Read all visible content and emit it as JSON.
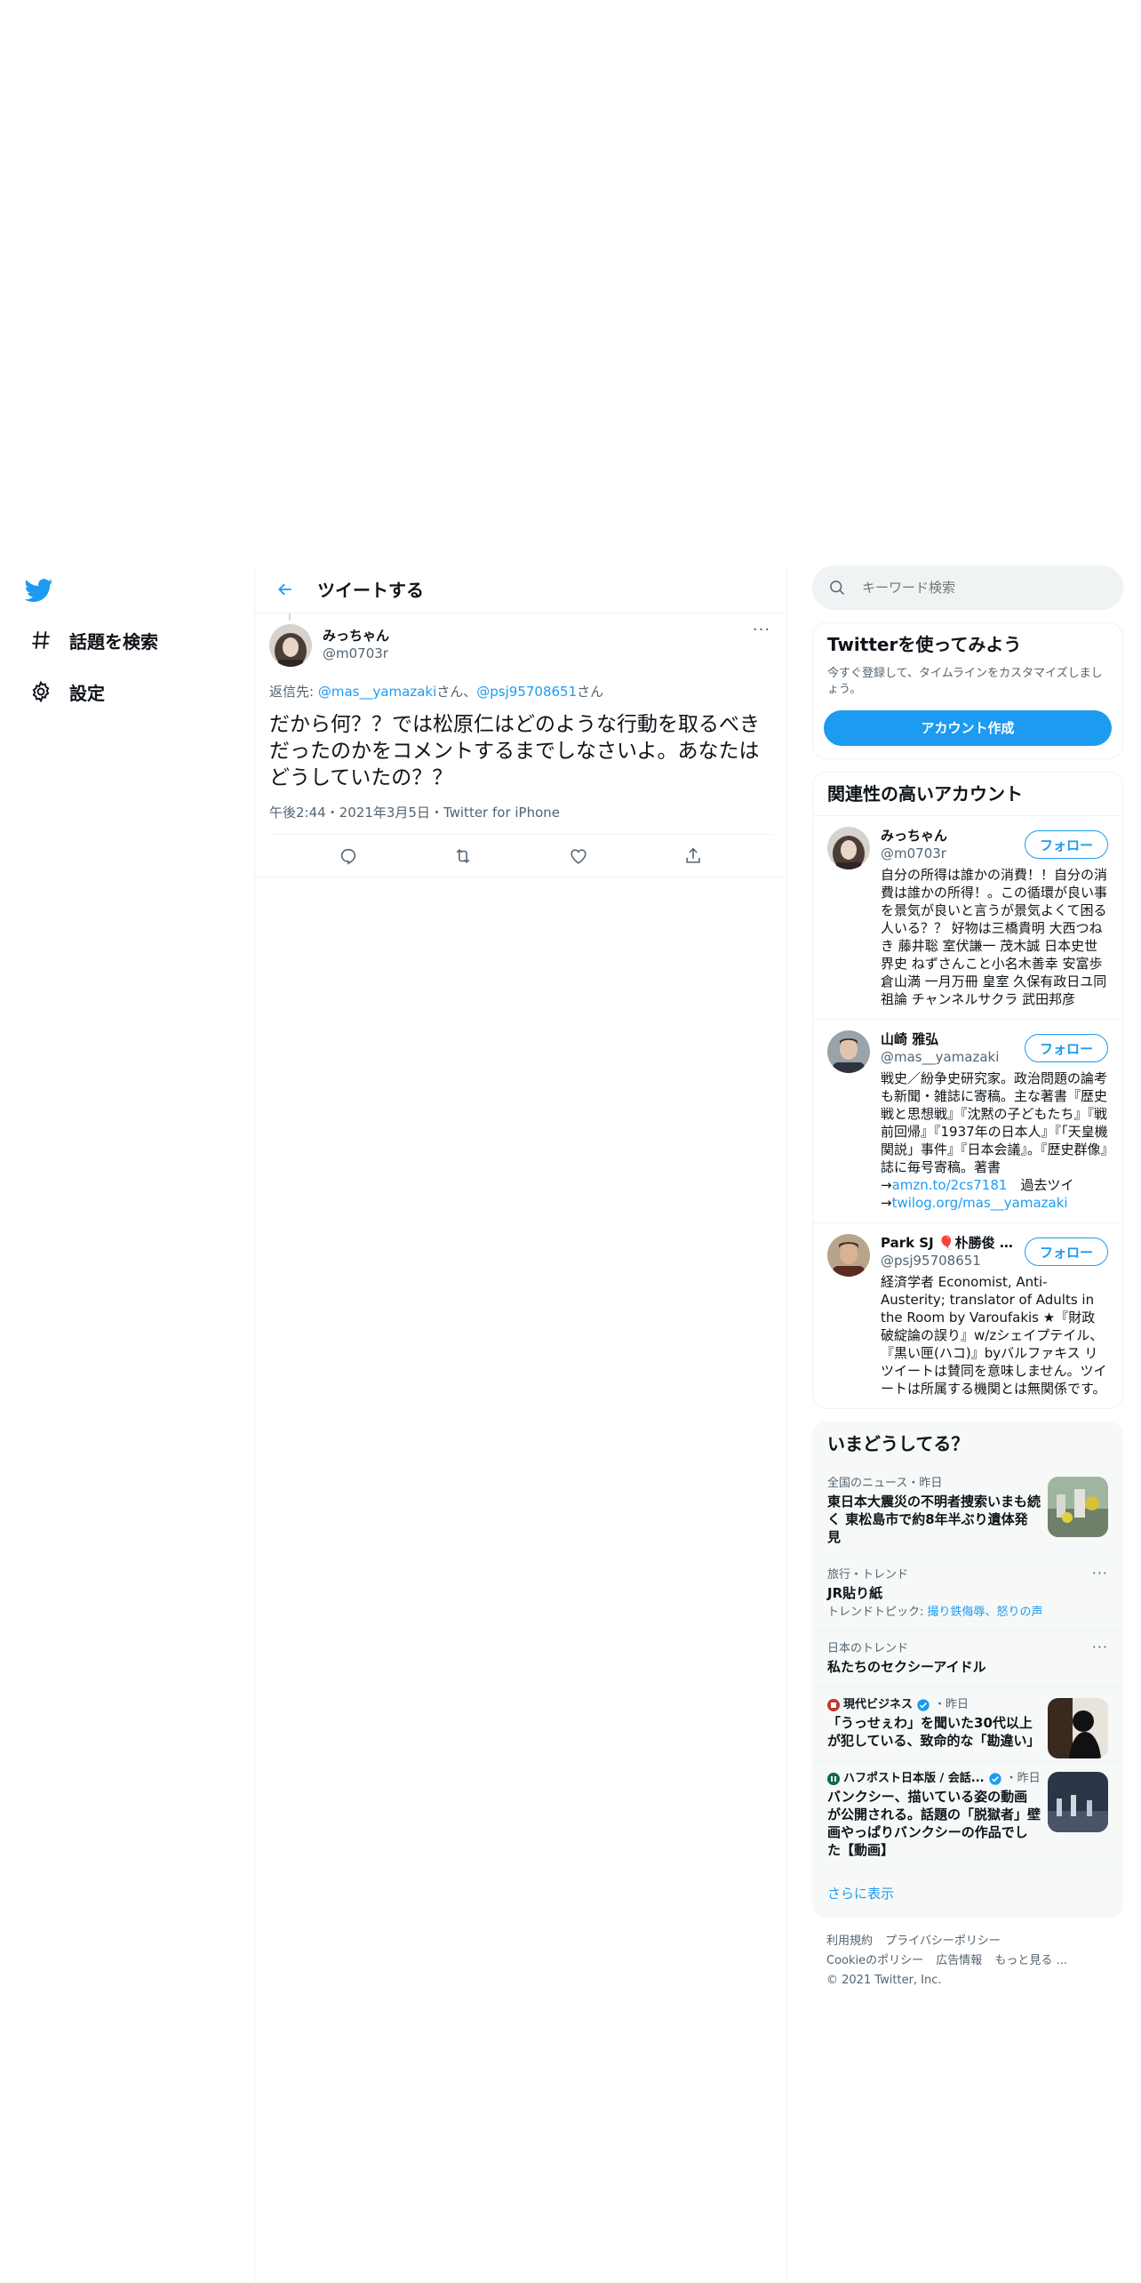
{
  "nav": {
    "explore_label": "話題を検索",
    "settings_label": "設定"
  },
  "main": {
    "title": "ツイートする",
    "tweet": {
      "name": "みっちゃん",
      "handle": "@m0703r",
      "reply_prefix": "返信先: ",
      "reply_user1": "@mas__yamazaki",
      "reply_san1": "さん、",
      "reply_user2": "@psj95708651",
      "reply_san2": "さん",
      "text": "だから何？？では松原仁はどのような行動を取るべきだったのかをコメントするまでしなさいよ。あなたはどうしていたの？？",
      "meta": "午後2:44・2021年3月5日・Twitter for iPhone"
    }
  },
  "search": {
    "placeholder": "キーワード検索"
  },
  "signup": {
    "title": "Twitterを使ってみよう",
    "desc": "今すぐ登録して、タイムラインをカスタマイズしましょう。",
    "button": "アカウント作成"
  },
  "relevant": {
    "title": "関連性の高いアカウント",
    "follow_label": "フォロー",
    "accounts": [
      {
        "name": "みっちゃん",
        "handle": "@m0703r",
        "bio": "自分の所得は誰かの消費！！自分の消費は誰かの所得！。この循環が良い事を景気が良いと言うが景気よくて困る人いる？？ 好物は三橋貴明 大西つねき 藤井聡 室伏謙一 茂木誠 日本史世界史 ねずさんこと小名木善幸 安富歩 倉山満 一月万冊 皇室 久保有政日ユ同祖論 チャンネルサクラ 武田邦彦"
      },
      {
        "name": "山崎 雅弘",
        "handle": "@mas__yamazaki",
        "bio": "戦史／紛争史研究家。政治問題の論考も新聞・雑誌に寄稿。主な著書『歴史戦と思想戦』『沈黙の子どもたち』『戦前回帰』『1937年の日本人』『「天皇機関説」事件』『日本会議』。『歴史群像』誌に毎号寄稿。著書→",
        "bio_link1": "amzn.to/2cs7181",
        "bio_mid": "　過去ツイ→",
        "bio_link2": "twilog.org/mas__yamazaki"
      },
      {
        "name": "Park SJ 🎈朴勝俊 A...",
        "handle": "@psj95708651",
        "bio": "経済学者 Economist, Anti-Austerity; translator of Adults in the Room by Varoufakis ★『財政破綻論の誤り』w/zシェイプテイル、『黒い匣(ハコ)』byバルファキス リツイートは賛同を意味しません。ツイートは所属する機関とは無関係です。"
      }
    ]
  },
  "trends": {
    "title": "いまどうしてる？",
    "items": [
      {
        "meta": "全国のニュース・昨日",
        "title": "東日本大震災の不明者捜索いまも続く 東松島市で約8年半ぶり遺体発見"
      },
      {
        "meta": "旅行・トレンド",
        "title": "JR貼り紙",
        "topics_prefix": "トレンドトピック: ",
        "topics": "撮り鉄侮辱、怒りの声"
      },
      {
        "meta": "日本のトレンド",
        "title": "私たちのセクシーアイドル"
      },
      {
        "source": "現代ビジネス",
        "meta": "・昨日",
        "title": "「うっせぇわ」を聞いた30代以上が犯している、致命的な「勘違い」"
      },
      {
        "source": "ハフポスト日本版 / 会話...",
        "meta": "・昨日",
        "title": "バンクシー、描いている姿の動画が公開される。話題の「脱獄者」壁画やっぱりバンクシーの作品でした【動画】"
      }
    ],
    "show_more": "さらに表示"
  },
  "footer": {
    "terms": "利用規約",
    "privacy": "プライバシーポリシー",
    "cookie": "Cookieのポリシー",
    "ads": "広告情報",
    "more": "もっと見る ...",
    "copyright": "© 2021 Twitter, Inc."
  },
  "colors": {
    "accent": "#1d9bf0",
    "text": "#0f1419",
    "muted": "#536471"
  }
}
